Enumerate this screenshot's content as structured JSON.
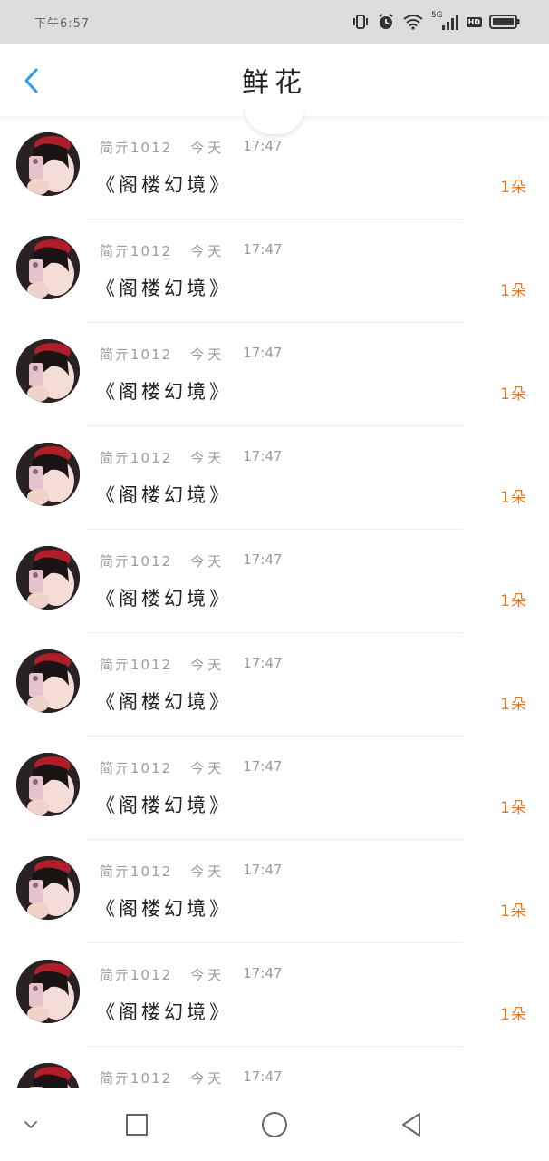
{
  "status_bar": {
    "time": "下午6:57",
    "icons": [
      "vibrate-icon",
      "alarm-icon",
      "wifi-icon",
      "signal-5g-icon",
      "hd-icon",
      "battery-icon"
    ],
    "network_label": "5G",
    "hd_label": "HD"
  },
  "header": {
    "title": "鲜花",
    "back_icon": "chevron-left-icon"
  },
  "items": [
    {
      "name": "简亓1012",
      "day": "今天",
      "time": "17:47",
      "title": "《阁楼幻境》",
      "count": "1朵"
    },
    {
      "name": "简亓1012",
      "day": "今天",
      "time": "17:47",
      "title": "《阁楼幻境》",
      "count": "1朵"
    },
    {
      "name": "简亓1012",
      "day": "今天",
      "time": "17:47",
      "title": "《阁楼幻境》",
      "count": "1朵"
    },
    {
      "name": "简亓1012",
      "day": "今天",
      "time": "17:47",
      "title": "《阁楼幻境》",
      "count": "1朵"
    },
    {
      "name": "简亓1012",
      "day": "今天",
      "time": "17:47",
      "title": "《阁楼幻境》",
      "count": "1朵"
    },
    {
      "name": "简亓1012",
      "day": "今天",
      "time": "17:47",
      "title": "《阁楼幻境》",
      "count": "1朵"
    },
    {
      "name": "简亓1012",
      "day": "今天",
      "time": "17:47",
      "title": "《阁楼幻境》",
      "count": "1朵"
    },
    {
      "name": "简亓1012",
      "day": "今天",
      "time": "17:47",
      "title": "《阁楼幻境》",
      "count": "1朵"
    },
    {
      "name": "简亓1012",
      "day": "今天",
      "time": "17:47",
      "title": "《阁楼幻境》",
      "count": "1朵"
    },
    {
      "name": "简亓1012",
      "day": "今天",
      "time": "17:47",
      "title": "",
      "count": ""
    }
  ],
  "nav_bar": {
    "icons": [
      "chevron-down-icon",
      "recents-square-icon",
      "home-circle-icon",
      "back-triangle-icon"
    ]
  },
  "colors": {
    "accent_blue": "#2b9bf4",
    "count_orange": "#e07a2e",
    "status_bar_bg": "#dcdcdc",
    "meta_gray": "#9a9a9a"
  }
}
